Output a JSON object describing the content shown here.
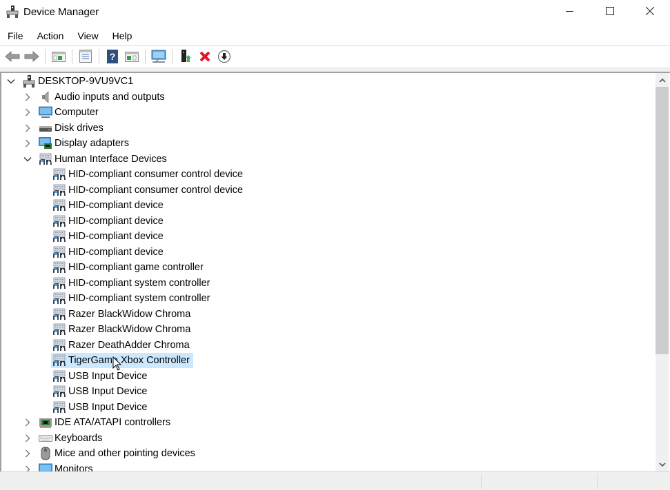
{
  "window": {
    "title": "Device Manager",
    "controls": {
      "minimize": "minimize",
      "maximize": "maximize",
      "close": "close"
    }
  },
  "menu": [
    "File",
    "Action",
    "View",
    "Help"
  ],
  "toolbar": {
    "buttons": [
      {
        "name": "back",
        "icon": "back-arrow-icon",
        "tooltip": "Back"
      },
      {
        "name": "forward",
        "icon": "forward-arrow-icon",
        "tooltip": "Forward"
      },
      {
        "name": "show-hide-console-tree",
        "icon": "console-tree-icon"
      },
      {
        "name": "properties",
        "icon": "properties-icon"
      },
      {
        "name": "help",
        "icon": "help-icon"
      },
      {
        "name": "show-hide-action-pane",
        "icon": "action-pane-icon"
      },
      {
        "name": "scan-hardware-changes",
        "icon": "monitor-scan-icon"
      },
      {
        "name": "update-driver",
        "icon": "update-driver-icon"
      },
      {
        "name": "uninstall-device",
        "icon": "uninstall-x-icon"
      },
      {
        "name": "disable-device",
        "icon": "disable-down-arrow-icon"
      }
    ]
  },
  "tree": {
    "root": {
      "label": "DESKTOP-9VU9VC1",
      "expanded": true,
      "icon": "computer-tower-icon"
    },
    "categories": [
      {
        "label": "Audio inputs and outputs",
        "icon": "speaker-icon",
        "expanded": false
      },
      {
        "label": "Computer",
        "icon": "monitor-icon",
        "expanded": false
      },
      {
        "label": "Disk drives",
        "icon": "disk-drive-icon",
        "expanded": false
      },
      {
        "label": "Display adapters",
        "icon": "display-adapter-icon",
        "expanded": false
      },
      {
        "label": "Human Interface Devices",
        "icon": "hid-icon",
        "expanded": true,
        "children": [
          {
            "label": "HID-compliant consumer control device"
          },
          {
            "label": "HID-compliant consumer control device"
          },
          {
            "label": "HID-compliant device"
          },
          {
            "label": "HID-compliant device"
          },
          {
            "label": "HID-compliant device"
          },
          {
            "label": "HID-compliant device"
          },
          {
            "label": "HID-compliant game controller"
          },
          {
            "label": "HID-compliant system controller"
          },
          {
            "label": "HID-compliant system controller"
          },
          {
            "label": "Razer BlackWidow Chroma"
          },
          {
            "label": "Razer BlackWidow Chroma"
          },
          {
            "label": "Razer DeathAdder Chroma"
          },
          {
            "label": "TigerGame Xbox Controller",
            "selected": true
          },
          {
            "label": "USB Input Device"
          },
          {
            "label": "USB Input Device"
          },
          {
            "label": "USB Input Device"
          }
        ]
      },
      {
        "label": "IDE ATA/ATAPI controllers",
        "icon": "ide-controller-icon",
        "expanded": false
      },
      {
        "label": "Keyboards",
        "icon": "keyboard-icon",
        "expanded": false
      },
      {
        "label": "Mice and other pointing devices",
        "icon": "mouse-icon",
        "expanded": false
      },
      {
        "label": "Monitors",
        "icon": "monitor-icon",
        "expanded": false
      }
    ]
  },
  "colors": {
    "selection": "#cce8ff",
    "scrollbar_thumb": "#cdcdcd",
    "uninstall_red": "#e81123"
  }
}
